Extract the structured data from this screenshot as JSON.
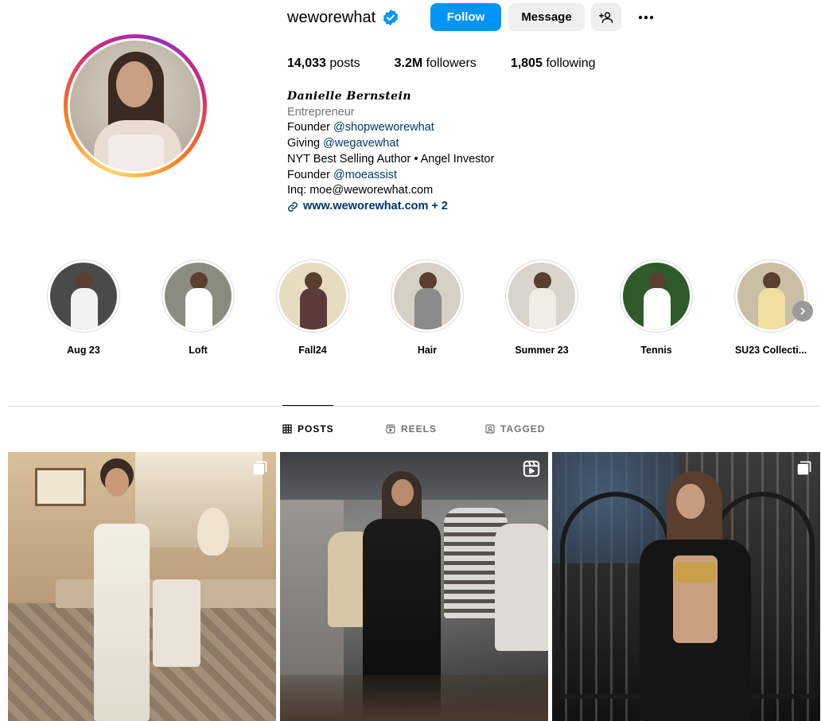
{
  "profile": {
    "username": "weworewhat",
    "follow_label": "Follow",
    "message_label": "Message",
    "stats": {
      "posts_count": "14,033",
      "posts_label": "posts",
      "followers_count": "3.2M",
      "followers_label": "followers",
      "following_count": "1,805",
      "following_label": "following"
    },
    "bio": {
      "full_name": "Danielle Bernstein",
      "category": "Entrepreneur",
      "line1_prefix": "Founder ",
      "line1_mention": "@shopweworewhat",
      "line2_prefix": "Giving ",
      "line2_mention": "@wegavewhat",
      "line3": "NYT Best Selling Author • Angel Investor",
      "line4_prefix": "Founder ",
      "line4_mention": "@moeassist",
      "line5": "Inq: moe@weworewhat.com",
      "link": "www.weworewhat.com + 2"
    }
  },
  "highlights": [
    {
      "label": "Aug 23",
      "bg": "#4a4a4a",
      "outfit": "#f2f2f2"
    },
    {
      "label": "Loft",
      "bg": "#8a8c80",
      "outfit": "#ffffff"
    },
    {
      "label": "Fall24",
      "bg": "#e8dcc0",
      "outfit": "#5b3a3a"
    },
    {
      "label": "Hair",
      "bg": "#d6d0c6",
      "outfit": "#8a8a8a"
    },
    {
      "label": "Summer 23",
      "bg": "#d9d4cc",
      "outfit": "#f0ece6"
    },
    {
      "label": "Tennis",
      "bg": "#2f5a2c",
      "outfit": "#ffffff"
    },
    {
      "label": "SU23 Collecti...",
      "bg": "#c8bfa4",
      "outfit": "#efe0a0"
    }
  ],
  "tabs": {
    "posts": "POSTS",
    "reels": "REELS",
    "tagged": "TAGGED"
  },
  "colors": {
    "follow_blue": "#0095f6",
    "link_blue": "#00376b",
    "muted_gray": "#737373"
  }
}
